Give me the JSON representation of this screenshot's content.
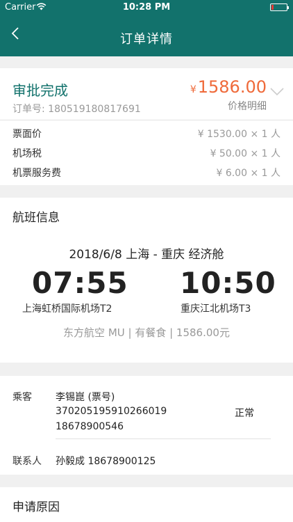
{
  "status_bar": {
    "carrier": "Carrier",
    "time": "10:28 PM"
  },
  "nav": {
    "title": "订单详情"
  },
  "order": {
    "status": "审批完成",
    "order_no_label": "订单号:",
    "order_no": "180519180817691",
    "price_currency": "¥",
    "price": "1586.00",
    "price_detail_label": "价格明细"
  },
  "fees": [
    {
      "label": "票面价",
      "value": "¥ 1530.00 × 1 人"
    },
    {
      "label": "机场税",
      "value": "¥ 50.00 × 1 人"
    },
    {
      "label": "机票服务费",
      "value": "¥ 6.00 × 1 人"
    }
  ],
  "flight": {
    "section_title": "航班信息",
    "route": "2018/6/8  上海 - 重庆  经济舱",
    "depart_time": "07:55",
    "arrive_time": "10:50",
    "depart_airport": "上海虹桥国际机场T2",
    "arrive_airport": "重庆江北机场T3",
    "info": "东方航空 MU | 有餐食 | 1586.00元"
  },
  "passenger": {
    "label": "乘客",
    "name": "李锡崑 (票号)",
    "id_number": "370205195910266019",
    "phone": "18678900546",
    "status": "正常"
  },
  "contact": {
    "label": "联系人",
    "value": "孙毅成 18678900125"
  },
  "reason": {
    "section_title": "申请原因"
  },
  "colors": {
    "primary": "#12726c",
    "price": "#ef6a3a"
  }
}
